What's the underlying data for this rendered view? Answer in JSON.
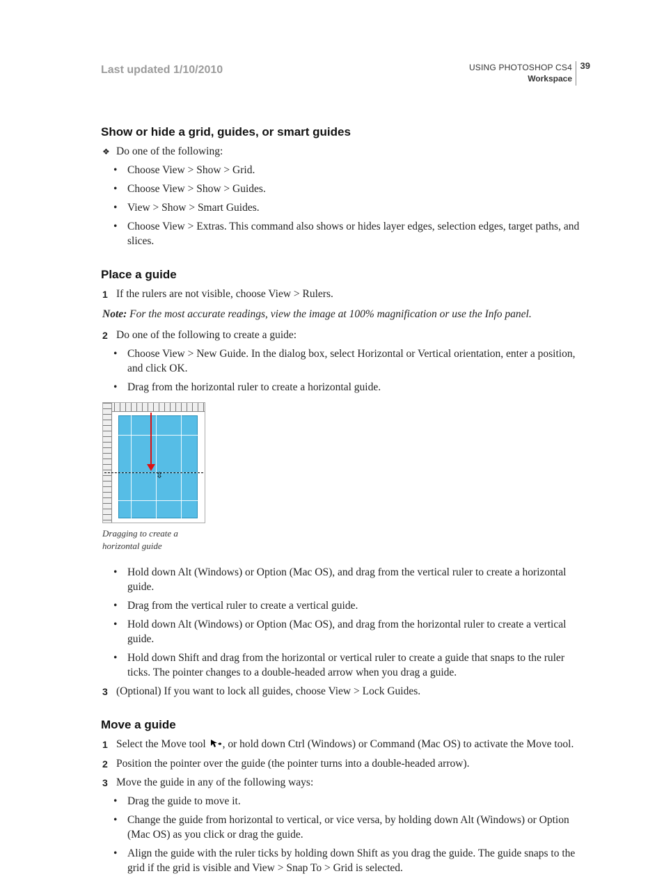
{
  "header": {
    "updated": "Last updated 1/10/2010",
    "doc_title": "USING PHOTOSHOP CS4",
    "section": "Workspace",
    "page_number": "39"
  },
  "sections": [
    {
      "heading": "Show or hide a grid, guides, or smart guides",
      "items": [
        {
          "marker": "❖",
          "level": 0,
          "text": "Do one of the following:"
        },
        {
          "marker": "•",
          "level": 1,
          "text": "Choose View > Show > Grid."
        },
        {
          "marker": "•",
          "level": 1,
          "text": "Choose View > Show > Guides."
        },
        {
          "marker": "•",
          "level": 1,
          "text": "View > Show > Smart Guides."
        },
        {
          "marker": "•",
          "level": 1,
          "text": "Choose View > Extras. This command also shows or hides layer edges, selection edges, target paths, and slices."
        }
      ]
    },
    {
      "heading": "Place a guide",
      "pre_items": [
        {
          "marker": "1",
          "level": 0,
          "text": "If the rulers are not visible, choose View > Rulers."
        }
      ],
      "note": {
        "label": "Note:",
        "text": " For the most accurate readings, view the image at 100% magnification or use the Info panel."
      },
      "items": [
        {
          "marker": "2",
          "level": 0,
          "text": "Do one of the following to create a guide:"
        },
        {
          "marker": "•",
          "level": 1,
          "text": "Choose View > New Guide. In the dialog box, select Horizontal or Vertical orientation, enter a position, and click OK."
        },
        {
          "marker": "•",
          "level": 1,
          "text": "Drag from the horizontal ruler to create a horizontal guide."
        }
      ],
      "figure_caption": "Dragging to create a horizontal guide",
      "post_items": [
        {
          "marker": "•",
          "level": 1,
          "text": "Hold down Alt (Windows) or Option (Mac OS), and drag from the vertical ruler to create a horizontal guide."
        },
        {
          "marker": "•",
          "level": 1,
          "text": "Drag from the vertical ruler to create a vertical guide."
        },
        {
          "marker": "•",
          "level": 1,
          "text": "Hold down Alt (Windows) or Option (Mac OS), and drag from the horizontal ruler to create a vertical guide."
        },
        {
          "marker": "•",
          "level": 1,
          "text": "Hold down Shift and drag from the horizontal or vertical ruler to create a guide that snaps to the ruler ticks. The pointer changes to a double-headed arrow when you drag a guide."
        },
        {
          "marker": "3",
          "level": 0,
          "text": "(Optional) If you want to lock all guides, choose View > Lock Guides."
        }
      ]
    },
    {
      "heading": "Move a guide",
      "items": [
        {
          "marker": "1",
          "level": 0,
          "text_before": "Select the Move tool ",
          "text_after": ", or hold down Ctrl (Windows) or Command (Mac OS) to activate the Move tool.",
          "has_icon": true
        },
        {
          "marker": "2",
          "level": 0,
          "text": "Position the pointer over the guide (the pointer turns into a double-headed arrow)."
        },
        {
          "marker": "3",
          "level": 0,
          "text": "Move the guide in any of the following ways:"
        },
        {
          "marker": "•",
          "level": 1,
          "text": "Drag the guide to move it."
        },
        {
          "marker": "•",
          "level": 1,
          "text": "Change the guide from horizontal to vertical, or vice versa, by holding down Alt (Windows) or Option (Mac OS) as you click or drag the guide."
        },
        {
          "marker": "•",
          "level": 1,
          "text": "Align the guide with the ruler ticks by holding down Shift as you drag the guide. The guide snaps to the grid if the grid is visible and View > Snap To > Grid is selected."
        }
      ]
    }
  ]
}
